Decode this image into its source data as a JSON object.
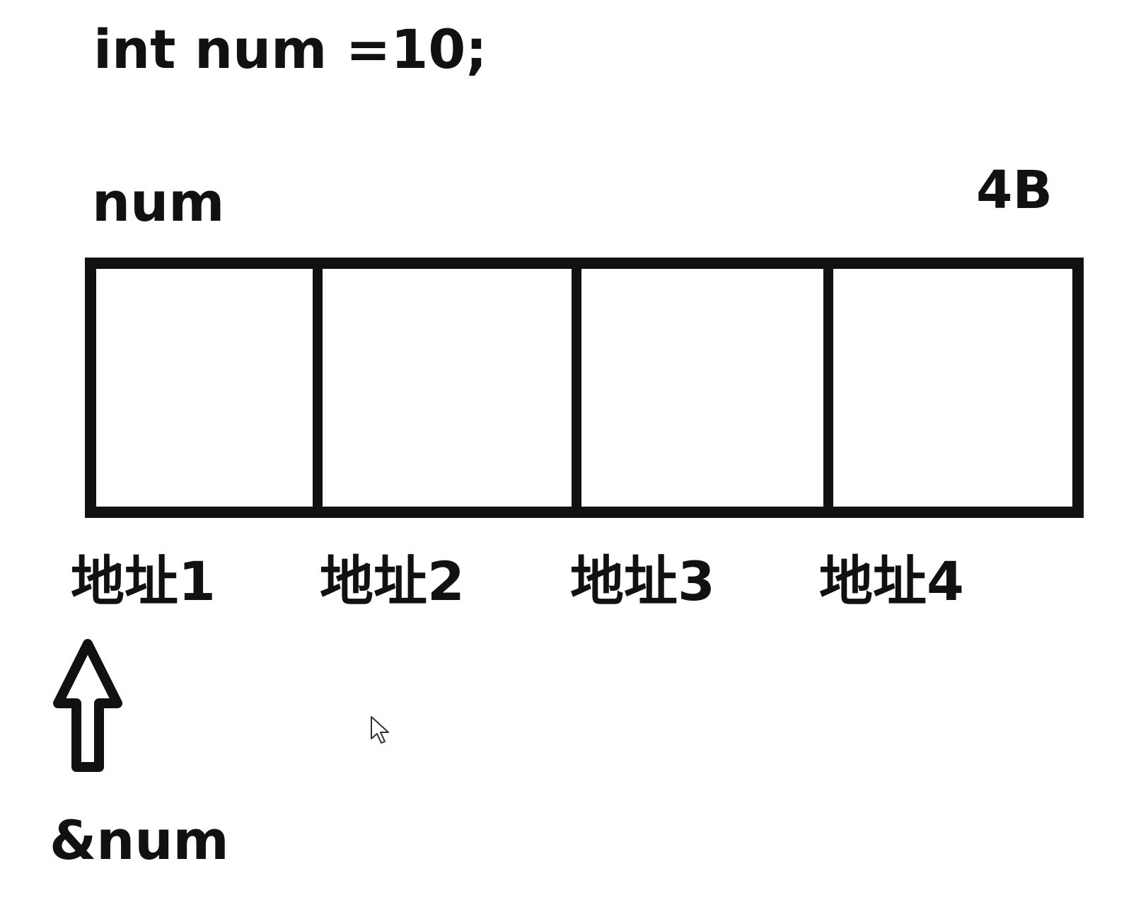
{
  "code": "int num =10;",
  "variable_name": "num",
  "size_label": "4B",
  "addresses": [
    "地址1",
    "地址2",
    "地址3",
    "地址4"
  ],
  "reference_label": "&num",
  "colors": {
    "stroke": "#111111",
    "background": "#ffffff"
  },
  "icons": {
    "arrow": "up-arrow-icon",
    "cursor": "mouse-pointer-icon"
  }
}
